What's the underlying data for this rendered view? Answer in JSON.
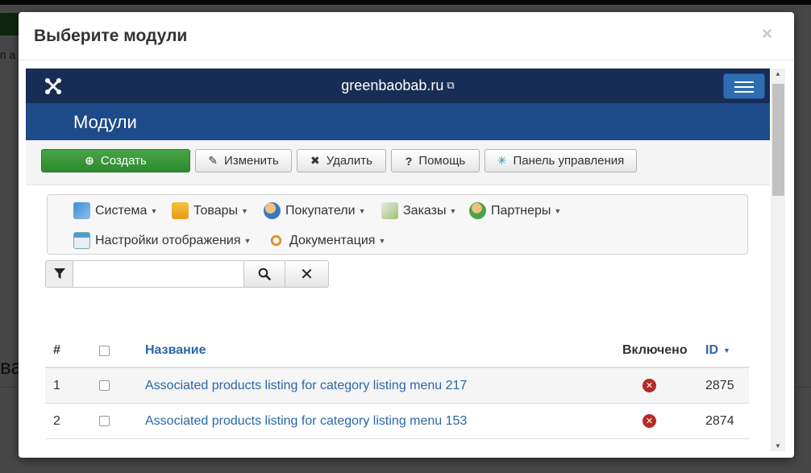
{
  "background": {
    "text_partial": "п а",
    "heading_partial": "ва"
  },
  "modal": {
    "title": "Выберите модули",
    "close_label": "×"
  },
  "frame": {
    "site_name": "greenbaobab.ru",
    "external_link_icon": "external-link-icon",
    "page_title": "Модули",
    "toolbar": {
      "create": "Создать",
      "edit": "Изменить",
      "delete": "Удалить",
      "help": "Помощь",
      "dashboard": "Панель управления"
    },
    "menu": {
      "system": "Система",
      "goods": "Товары",
      "customers": "Покупатели",
      "orders": "Заказы",
      "partners": "Партнеры",
      "display_settings": "Настройки отображения",
      "documentation": "Документация"
    },
    "search": {
      "value": "",
      "placeholder": ""
    },
    "table": {
      "headers": {
        "num": "#",
        "name": "Название",
        "enabled": "Включено",
        "id": "ID"
      },
      "rows": [
        {
          "num": "1",
          "name": "Associated products listing for category listing menu 217",
          "enabled": "no",
          "id": "2875"
        },
        {
          "num": "2",
          "name": "Associated products listing for category listing menu 153",
          "enabled": "no",
          "id": "2874"
        }
      ]
    }
  },
  "colors": {
    "navbar": "#172d55",
    "subhead": "#1d4a88",
    "success": "#2f8a2f",
    "link": "#2b66a8",
    "disabled_status": "#b52b27"
  }
}
